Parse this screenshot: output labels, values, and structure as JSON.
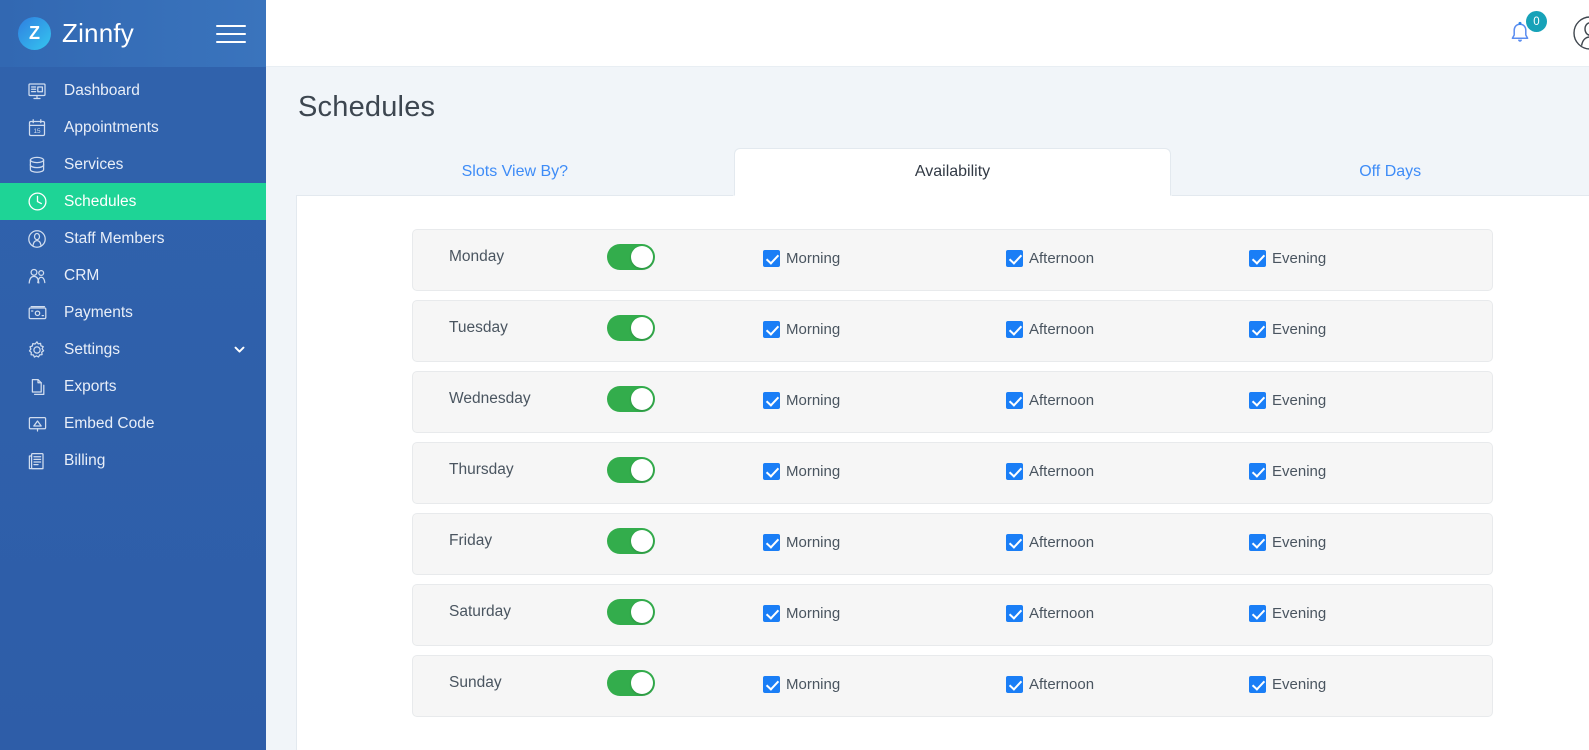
{
  "brand": {
    "name": "Zinnfy",
    "logo_letter": "Z",
    "menu_icon": "hamburger-menu-icon"
  },
  "sidebar": {
    "items": [
      {
        "label": "Dashboard",
        "icon": "monitor-icon",
        "active": false,
        "has_chevron": false
      },
      {
        "label": "Appointments",
        "icon": "calendar-icon",
        "active": false,
        "has_chevron": false
      },
      {
        "label": "Services",
        "icon": "database-icon",
        "active": false,
        "has_chevron": false
      },
      {
        "label": "Schedules",
        "icon": "clock-icon",
        "active": true,
        "has_chevron": false
      },
      {
        "label": "Staff Members",
        "icon": "user-circle-icon",
        "active": false,
        "has_chevron": false
      },
      {
        "label": "CRM",
        "icon": "users-group-icon",
        "active": false,
        "has_chevron": false
      },
      {
        "label": "Payments",
        "icon": "payment-card-icon",
        "active": false,
        "has_chevron": false
      },
      {
        "label": "Settings",
        "icon": "gear-icon",
        "active": false,
        "has_chevron": true
      },
      {
        "label": "Exports",
        "icon": "documents-icon",
        "active": false,
        "has_chevron": false
      },
      {
        "label": "Embed Code",
        "icon": "presentation-icon",
        "active": false,
        "has_chevron": false
      },
      {
        "label": "Billing",
        "icon": "newspaper-icon",
        "active": false,
        "has_chevron": false
      }
    ]
  },
  "topbar": {
    "notification_icon": "bell-icon",
    "notification_count": "0",
    "profile_icon": "user-avatar-icon"
  },
  "page": {
    "title": "Schedules"
  },
  "tabs": [
    {
      "label": "Slots View By?",
      "active": false
    },
    {
      "label": "Availability",
      "active": true
    },
    {
      "label": "Off Days",
      "active": false
    }
  ],
  "availability": {
    "slot_labels": [
      "Morning",
      "Afternoon",
      "Evening"
    ],
    "rows": [
      {
        "day": "Monday",
        "enabled": true,
        "slots": [
          true,
          true,
          true
        ]
      },
      {
        "day": "Tuesday",
        "enabled": true,
        "slots": [
          true,
          true,
          true
        ]
      },
      {
        "day": "Wednesday",
        "enabled": true,
        "slots": [
          true,
          true,
          true
        ]
      },
      {
        "day": "Thursday",
        "enabled": true,
        "slots": [
          true,
          true,
          true
        ]
      },
      {
        "day": "Friday",
        "enabled": true,
        "slots": [
          true,
          true,
          true
        ]
      },
      {
        "day": "Saturday",
        "enabled": true,
        "slots": [
          true,
          true,
          true
        ]
      },
      {
        "day": "Sunday",
        "enabled": true,
        "slots": [
          true,
          true,
          true
        ]
      }
    ]
  },
  "colors": {
    "sidebar_bg": "#2f60ab",
    "sidebar_active": "#1ed496",
    "toggle_on": "#33ad4c",
    "checkbox": "#1a7ef6",
    "tab_link": "#3e8cf7",
    "badge": "#17a2b8",
    "page_bg": "#f1f5f9"
  }
}
